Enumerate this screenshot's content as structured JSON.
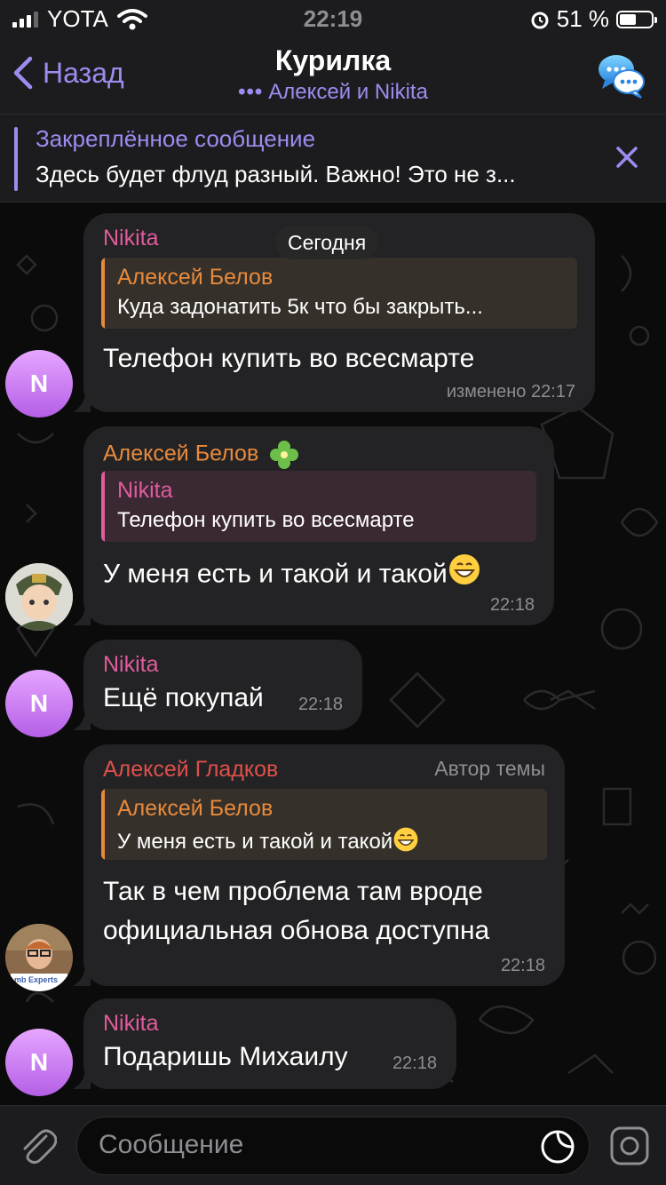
{
  "status": {
    "carrier": "YOTA",
    "time": "22:19",
    "battery": "51 %"
  },
  "nav": {
    "back": "Назад",
    "title": "Курилка",
    "subtitle": "Алексей и Nikita"
  },
  "pinned": {
    "title": "Закреплённое сообщение",
    "text": "Здесь будет флуд разный. Важно! Это не з..."
  },
  "date_label": "Сегодня",
  "messages": [
    {
      "sender": "Nikita",
      "reply_name": "Алексей Белов",
      "reply_text": "Куда задонатить 5к что бы закрыть...",
      "text": "Телефон купить во всесмарте",
      "time": "изменено 22:17"
    },
    {
      "sender": "Алексей Белов",
      "reply_name": "Nikita",
      "reply_text": "Телефон купить во всесмарте",
      "text": "У меня есть и такой и такой",
      "time": "22:18"
    },
    {
      "sender": "Nikita",
      "text": "Ещё покупай",
      "time": "22:18"
    },
    {
      "sender": "Алексей Гладков",
      "badge": "Автор темы",
      "reply_name": "Алексей Белов",
      "reply_text": "У меня есть и такой и такой",
      "text_line1": "Так в чем проблема там вроде",
      "text_line2": "официальная обнова доступна",
      "time": "22:18"
    },
    {
      "sender": "Nikita",
      "text": "Подаришь Михаилу",
      "time": "22:18"
    }
  ],
  "avatars": {
    "nikita_initial": "N",
    "logo_text": "mb Experts"
  },
  "input": {
    "placeholder": "Сообщение"
  },
  "colors": {
    "accent": "#9d8cf0",
    "nikita": "#e05c9c",
    "belov": "#e88a3c",
    "gladkov": "#e0504a",
    "bubble": "#232325"
  }
}
